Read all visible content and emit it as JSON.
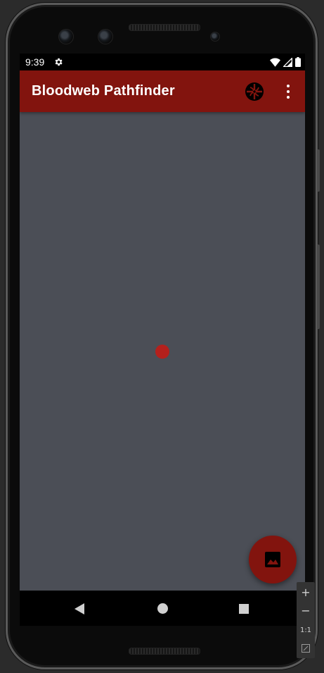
{
  "status_bar": {
    "time": "9:39",
    "icons": [
      "settings-gear-icon",
      "wifi-icon",
      "signal-icon",
      "battery-icon"
    ]
  },
  "app_bar": {
    "title": "Bloodweb Pathfinder",
    "logo_icon": "entity-logo-icon",
    "menu_icon": "overflow-menu-icon"
  },
  "canvas": {
    "nodes": [
      {
        "name": "center-node",
        "color": "#b4201c"
      }
    ]
  },
  "fab": {
    "icon": "image-icon"
  },
  "nav_bar": {
    "buttons": [
      "back",
      "home",
      "recents"
    ]
  },
  "emulator_toolbar": {
    "zoom_in": "+",
    "zoom_out": "−",
    "one_to_one": "1:1"
  },
  "colors": {
    "accent": "#82140e",
    "background": "#4b4e56",
    "node": "#b4201c"
  }
}
